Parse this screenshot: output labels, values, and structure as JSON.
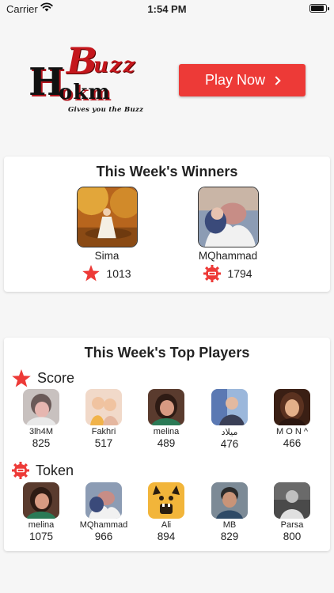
{
  "status_bar": {
    "carrier": "Carrier",
    "time": "1:54 PM"
  },
  "logo": {
    "h": "H",
    "okm": "okm",
    "b": "B",
    "uzz": "uzz",
    "tagline": "Gives you the Buzz"
  },
  "play_button": {
    "label": "Play Now"
  },
  "winners": {
    "title": "This Week's Winners",
    "items": [
      {
        "name": "Sima",
        "icon": "star-icon",
        "value": "1013"
      },
      {
        "name": "MQhammad",
        "icon": "token-icon",
        "value": "1794"
      }
    ]
  },
  "top_players": {
    "title": "This Week's Top Players",
    "score_label": "Score",
    "token_label": "Token",
    "score": [
      {
        "name": "3lh4M",
        "value": "825"
      },
      {
        "name": "Fakhri",
        "value": "517"
      },
      {
        "name": "melina",
        "value": "489"
      },
      {
        "name": "میلاد",
        "value": "476"
      },
      {
        "name": "M O N ^",
        "value": "466"
      }
    ],
    "token": [
      {
        "name": "melina",
        "value": "1075"
      },
      {
        "name": "MQhammad",
        "value": "966"
      },
      {
        "name": "Ali",
        "value": "894"
      },
      {
        "name": "MB",
        "value": "829"
      },
      {
        "name": "Parsa",
        "value": "800"
      }
    ]
  },
  "colors": {
    "accent": "#ed3a37",
    "background": "#f6f6f6",
    "card": "#ffffff"
  }
}
